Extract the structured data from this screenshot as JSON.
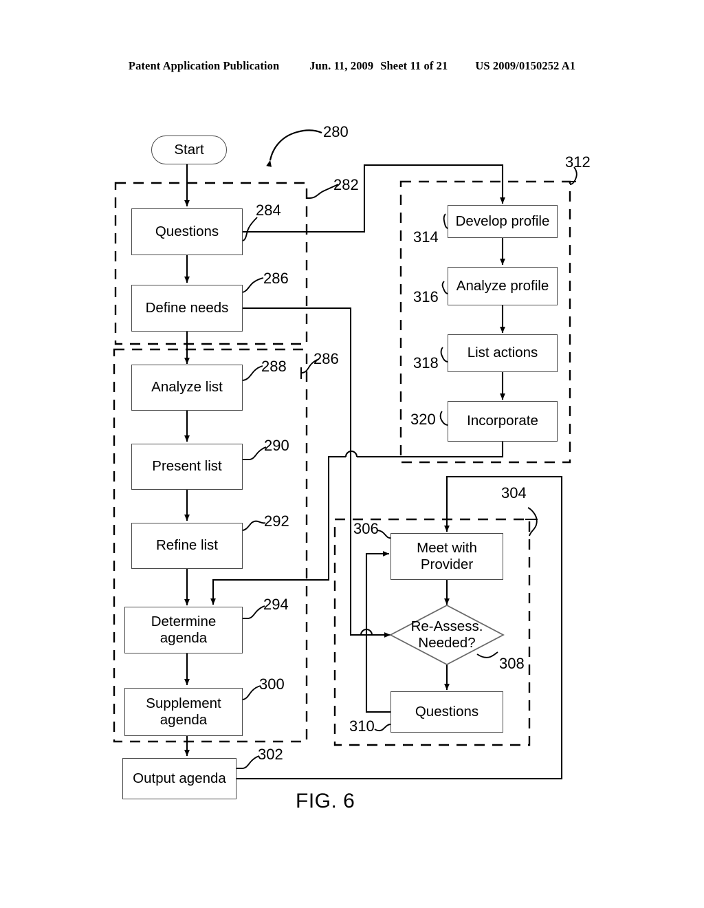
{
  "header": {
    "publication": "Patent Application Publication",
    "date": "Jun. 11, 2009",
    "sheet": "Sheet 11 of 21",
    "docnum": "US 2009/0150252 A1"
  },
  "figure": {
    "caption": "FIG. 6",
    "overall_ref": "280"
  },
  "nodes": {
    "start": "Start",
    "questions": "Questions",
    "define_needs": "Define needs",
    "analyze_list": "Analyze list",
    "present_list": "Present list",
    "refine_list": "Refine list",
    "determine_agenda": "Determine\nagenda",
    "determine_agenda_l1": "Determine",
    "determine_agenda_l2": "agenda",
    "supplement_agenda_l1": "Supplement",
    "supplement_agenda_l2": "agenda",
    "output_agenda": "Output agenda",
    "develop_profile": "Develop profile",
    "analyze_profile": "Analyze profile",
    "list_actions": "List actions",
    "incorporate": "Incorporate",
    "meet_with_provider_l1": "Meet with",
    "meet_with_provider_l2": "Provider",
    "reassess_l1": "Re-Assess.",
    "reassess_l2": "Needed?",
    "questions_2": "Questions"
  },
  "refs": {
    "r280": "280",
    "r282": "282",
    "r284": "284",
    "r286a": "286",
    "r286b": "286",
    "r288": "288",
    "r290": "290",
    "r292": "292",
    "r294": "294",
    "r300": "300",
    "r302": "302",
    "r304": "304",
    "r306": "306",
    "r308": "308",
    "r310": "310",
    "r312": "312",
    "r314": "314",
    "r316": "316",
    "r318": "318",
    "r320": "320"
  },
  "colors": {
    "ink": "#000000",
    "box_stroke": "#4a4a4a",
    "background": "#ffffff"
  }
}
